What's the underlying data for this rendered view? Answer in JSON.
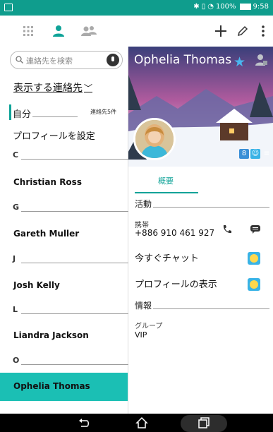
{
  "status_bar": {
    "battery": "100%",
    "time": "9:58"
  },
  "search": {
    "placeholder": "連絡先を検索"
  },
  "filter": {
    "label": "表示する連絡先"
  },
  "self": {
    "label": "自分",
    "count": "連絡先5件"
  },
  "profile_setup": "プロフィールを設定",
  "contacts": [
    {
      "section": "C",
      "name": "Christian Ross"
    },
    {
      "section": "G",
      "name": "Gareth Muller"
    },
    {
      "section": "J",
      "name": "Josh Kelly"
    },
    {
      "section": "L",
      "name": "Liandra Jackson"
    },
    {
      "section": "O",
      "name": "Ophelia Thomas",
      "selected": true
    }
  ],
  "detail": {
    "name": "Ophelia Thomas",
    "tab": "概要",
    "activity_header": "活動",
    "phone_label": "携帯",
    "phone_number": "+886 910 461 927",
    "chat_now": "今すぐチャット",
    "view_profile": "プロフィールの表示",
    "info_header": "情報",
    "group_label": "グループ",
    "group_value": "VIP"
  },
  "colors": {
    "accent": "#0fa398",
    "selected_row": "#1bbfb4",
    "status_bar": "#0f9d8d",
    "star": "#4ab6ef"
  }
}
